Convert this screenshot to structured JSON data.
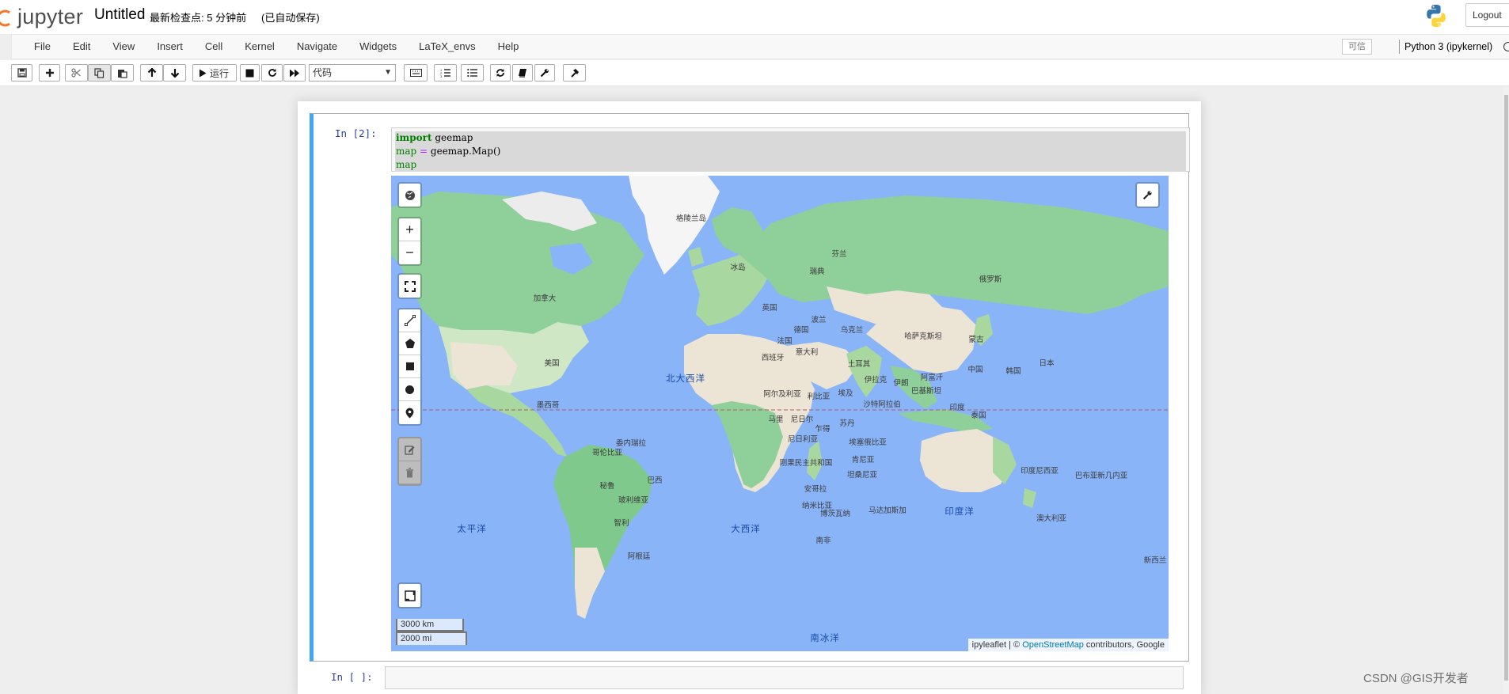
{
  "header": {
    "logo_text": "jupyter",
    "notebook_name": "Untitled",
    "checkpoint": "最新检查点: 5 分钟前",
    "autosave": "(已自动保存)",
    "logout_label": "Logout"
  },
  "menubar": {
    "items": [
      "File",
      "Edit",
      "View",
      "Insert",
      "Cell",
      "Kernel",
      "Navigate",
      "Widgets",
      "LaTeX_envs",
      "Help"
    ],
    "trusted_label": "可信",
    "kernel_name": "Python 3 (ipykernel)"
  },
  "toolbar": {
    "run_label": "运行",
    "cell_type": "代码",
    "icons": [
      "save-icon",
      "plus-icon",
      "cut-icon",
      "copy-icon",
      "paste-icon",
      "arrow-up-icon",
      "arrow-down-icon",
      "play-icon",
      "stop-icon",
      "restart-icon",
      "fast-forward-icon",
      "keyboard-icon",
      "numbered-list-icon",
      "bullet-list-icon",
      "refresh-icon",
      "book-icon",
      "wrench-icon",
      "hammer-icon"
    ]
  },
  "cells": [
    {
      "prompt": "In  [2]:",
      "code": {
        "line1": {
          "keyword": "import",
          "rest": " geemap"
        },
        "line2": {
          "var": "map",
          "op": " = ",
          "rest": "geemap.Map()"
        },
        "line3": {
          "var": "map"
        }
      }
    },
    {
      "prompt": "In  [ ]:",
      "code": ""
    }
  ],
  "map": {
    "controls": {
      "basemap_icon": "globe-icon",
      "settings_icon": "wrench-icon",
      "zoom_in": "+",
      "zoom_out": "−",
      "fullscreen_icon": "fullscreen-icon",
      "draw_tools": [
        "polyline-icon",
        "polygon-icon",
        "rectangle-icon",
        "circle-icon",
        "marker-icon"
      ],
      "edit_tools": [
        "edit-icon",
        "trash-icon"
      ],
      "layer_icon": "layers-icon"
    },
    "scale": {
      "km": "3000 km",
      "mi": "2000 mi"
    },
    "attribution": {
      "prefix": "ipyleaflet | © ",
      "link": "OpenStreetMap",
      "suffix": " contributors, Google"
    },
    "oceans": [
      "北大西洋",
      "太平洋",
      "大西洋",
      "印度洋",
      "南冰洋"
    ],
    "countries": [
      "格陵兰岛",
      "冰岛",
      "芬兰",
      "瑞典",
      "俄罗斯",
      "英国",
      "加拿大",
      "波兰",
      "德国",
      "乌克兰",
      "法国",
      "哈萨克斯坦",
      "蒙古",
      "西班牙",
      "意大利",
      "土耳其",
      "美国",
      "中国",
      "韩国",
      "日本",
      "北大西洋",
      "伊拉克",
      "伊朗",
      "阿富汗",
      "巴基斯坦",
      "阿尔及利亚",
      "利比亚",
      "埃及",
      "沙特阿拉伯",
      "印度",
      "墨西哥",
      "马里",
      "尼日尔",
      "苏丹",
      "泰国",
      "乍得",
      "尼日利亚",
      "埃塞俄比亚",
      "委内瑞拉",
      "哥伦比亚",
      "刚果民主共和国",
      "肯尼亚",
      "坦桑尼亚",
      "印度尼西亚",
      "巴布亚新几内亚",
      "巴西",
      "秘鲁",
      "安哥拉",
      "玻利维亚",
      "纳米比亚",
      "博茨瓦纳",
      "马达加斯加",
      "澳大利亚",
      "智利",
      "南非",
      "阿根廷",
      "新西兰"
    ]
  },
  "watermark": "CSDN @GIS开发者"
}
